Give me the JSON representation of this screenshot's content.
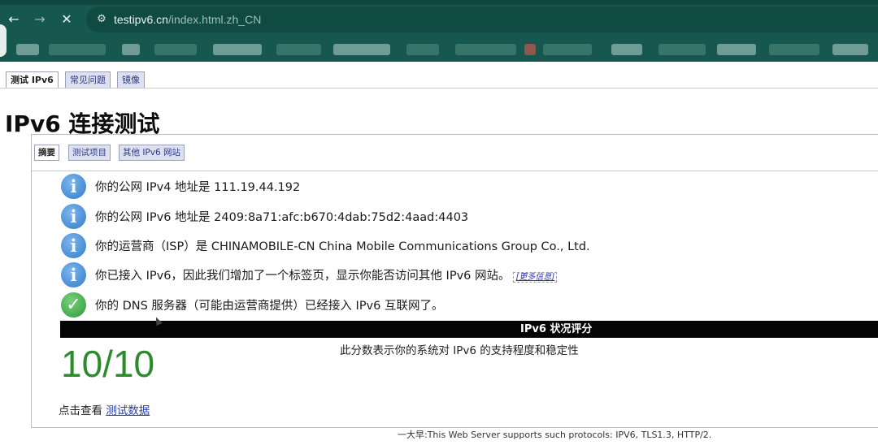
{
  "browser": {
    "url_host": "testipv6.cn",
    "url_path": "/index.html.zh_CN",
    "icons": {
      "back": "arrow-left-icon",
      "forward": "arrow-right-icon",
      "stop": "close-icon",
      "site_info": "tune-icon"
    }
  },
  "page_tabs": [
    {
      "label": "测试 IPv6",
      "active": true
    },
    {
      "label": "常见问题",
      "active": false
    },
    {
      "label": "镜像",
      "active": false
    }
  ],
  "page_title": "IPv6 连接测试",
  "inner_tabs": [
    {
      "label": "摘要",
      "active": true
    },
    {
      "label": "测试项目",
      "active": false
    },
    {
      "label": "其他 IPv6 网站",
      "active": false
    }
  ],
  "results": [
    {
      "icon": "info-icon",
      "text": "你的公网 IPv4 地址是 111.19.44.192"
    },
    {
      "icon": "info-icon",
      "text": "你的公网 IPv6 地址是 2409:8a71:afc:b670:4dab:75d2:4aad:4403"
    },
    {
      "icon": "info-icon",
      "text": "你的运营商（ISP）是 CHINAMOBILE-CN China Mobile Communications Group Co., Ltd."
    },
    {
      "icon": "info-icon",
      "text": "你已接入 IPv6，因此我们增加了一个标签页，显示你能否访问其他 IPv6 网站。",
      "link": "[更多信息]"
    },
    {
      "icon": "check-icon",
      "text": "你的 DNS 服务器（可能由运营商提供）已经接入 IPv6 互联网了。"
    }
  ],
  "score": {
    "header": "IPv6 状况评分",
    "description": "此分数表示你的系统对 IPv6 的支持程度和稳定性",
    "value": "10/10",
    "value_color": "#2d8a2d"
  },
  "detail": {
    "prefix": "点击查看",
    "link": "测试数据"
  },
  "footer": "一大早:This Web Server supports such protocols: IPV6, TLS1.3, HTTP/2.",
  "colors": {
    "chrome": "#16584f",
    "info": "#2f7dcd",
    "ok": "#2e9a3a",
    "score_bar": "#050505"
  }
}
